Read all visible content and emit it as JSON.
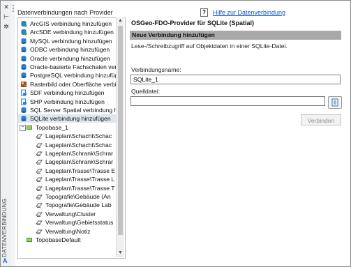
{
  "sidebar": {
    "vertical_title": "DATENVERBINDUNG",
    "bottom_icon": "A"
  },
  "providers": {
    "title": "Datenverbindungen nach Provider",
    "items": [
      {
        "label": "ArcGIS verbindung hinzufügen",
        "icon": "globe-db-icon",
        "color": "#2a7fd4"
      },
      {
        "label": "ArcSDE verbindung hinzufügen",
        "icon": "globe-db-icon",
        "color": "#2a7fd4"
      },
      {
        "label": "MySQL verbindung hinzufügen",
        "icon": "db-icon",
        "color": "#2a7fd4"
      },
      {
        "label": "ODBC verbindung hinzufügen",
        "icon": "db-icon",
        "color": "#2a7fd4"
      },
      {
        "label": "Oracle verbindung hinzufügen",
        "icon": "db-icon",
        "color": "#2a7fd4"
      },
      {
        "label": "Oracle-basierte Fachschalen verbi",
        "icon": "db-icon",
        "color": "#2a7fd4"
      },
      {
        "label": "PostgreSQL verbindung hinzufüg",
        "icon": "db-icon",
        "color": "#2a7fd4"
      },
      {
        "label": "Rasterbild oder Oberfläche verbi",
        "icon": "raster-icon",
        "color": "#c0392b"
      },
      {
        "label": "SDF verbindung hinzufügen",
        "icon": "file-db-icon",
        "color": "#2a7fd4"
      },
      {
        "label": "SHP verbindung hinzufügen",
        "icon": "file-db-icon",
        "color": "#2a7fd4"
      },
      {
        "label": "SQL Server Spatial verbindung hi",
        "icon": "db-icon",
        "color": "#2a7fd4"
      },
      {
        "label": "SQLite verbindung hinzufügen",
        "icon": "db-icon",
        "color": "#2a7fd4",
        "selected": true
      }
    ],
    "topobase": "Topobase_1",
    "layers": [
      "Lageplan\\Schacht\\Schac",
      "Lageplan\\Schacht\\Schac",
      "Lageplan\\Schrank\\Schrar",
      "Lageplan\\Schrank\\Schrar",
      "Lageplan\\Trasse\\Trasse E",
      "Lageplan\\Trasse\\Trasse L",
      "Lageplan\\Trasse\\Trasse T",
      "Topografie\\Gebäude (An",
      "Topografie\\Gebäude Lab",
      "Verwaltung\\Cluster",
      "Verwaltung\\Gebietsstatus",
      "Verwaltung\\Notiz"
    ],
    "topobase_default": "TopobaseDefault"
  },
  "help": {
    "icon": "?",
    "link": "Hilfe zur Datenverbindung"
  },
  "provider_panel": {
    "title": "OSGeo-FDO-Provider für SQLite (Spatial)",
    "section": "Neue Verbindung hinzufügen",
    "description": "Lese-/Schreibzugriff auf Objektdaten in einer SQLite-Datei.",
    "name_label": "Verbindungsname:",
    "name_value": "SQLite_1",
    "file_label": "Quelldatei:",
    "file_value": "",
    "connect_button": "Verbinden"
  },
  "colors": {
    "selection": "#dfe6ee",
    "section_header": "#a9a9a9",
    "link": "#1a55c8",
    "accent": "#2a7fd4"
  }
}
